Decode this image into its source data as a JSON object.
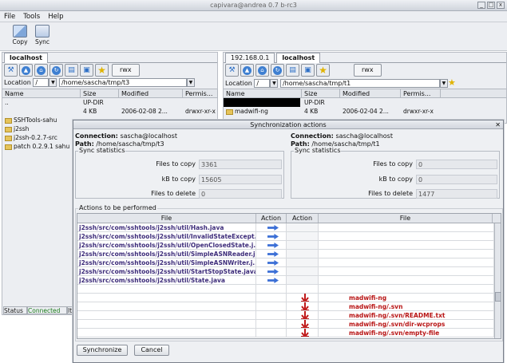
{
  "window": {
    "title": "capivara@andrea 0.7 b-rc3",
    "min_btn": "_",
    "max_btn": "□",
    "close_btn": "x"
  },
  "menu": {
    "file": "File",
    "tools": "Tools",
    "help": "Help"
  },
  "toolbar": {
    "copy": "Copy",
    "sync": "Sync"
  },
  "left": {
    "tab": "localhost",
    "rwx": "rwx",
    "location_label": "Location",
    "location_root": "/",
    "location_path": "/home/sascha/tmp/t3",
    "columns": [
      "Name",
      "Size",
      "Modified",
      "Permis..."
    ],
    "rows": [
      {
        "name": "..",
        "size": "UP-DIR",
        "modified": "",
        "perm": ""
      },
      {
        "name": "",
        "size": "4 KB",
        "modified": "2006-02-08 2...",
        "perm": "drwxr-xr-x"
      },
      {
        "name": "SSHTools-sahu",
        "size": "",
        "modified": "",
        "perm": ""
      },
      {
        "name": "j2ssh",
        "size": "",
        "modified": "",
        "perm": ""
      },
      {
        "name": "j2ssh-0.2.7-src",
        "size": "",
        "modified": "",
        "perm": ""
      },
      {
        "name": "patch 0.2.9.1 sahu",
        "size": "",
        "modified": "",
        "perm": ""
      }
    ],
    "status": [
      "Status",
      "Connected",
      "lt"
    ]
  },
  "right": {
    "tabs": [
      "192.168.0.1",
      "localhost"
    ],
    "rwx": "rwx",
    "location_label": "Location",
    "location_root": "/",
    "location_path": "/home/sascha/tmp/t1",
    "columns": [
      "Name",
      "Size",
      "Modified",
      "Permis..."
    ],
    "rows": [
      {
        "name": "",
        "size": "UP-DIR",
        "modified": "",
        "perm": ""
      },
      {
        "name": "madwifi-ng",
        "size": "4 KB",
        "modified": "2006-02-04 2...",
        "perm": "drwxr-xr-x"
      }
    ]
  },
  "dialog": {
    "title": "Synchronization actions",
    "left": {
      "connection_label": "Connection:",
      "connection": "sascha@localhost",
      "path_label": "Path:",
      "path": "/home/sascha/tmp/t3",
      "stats_legend": "Sync statistics",
      "files_copy_label": "Files to copy",
      "files_copy": "3361",
      "kb_copy_label": "kB to copy",
      "kb_copy": "15605",
      "files_delete_label": "Files to delete",
      "files_delete": "0"
    },
    "right": {
      "connection_label": "Connection:",
      "connection": "sascha@localhost",
      "path_label": "Path:",
      "path": "/home/sascha/tmp/t1",
      "stats_legend": "Sync statistics",
      "files_copy_label": "Files to copy",
      "files_copy": "0",
      "kb_copy_label": "kB to copy",
      "kb_copy": "0",
      "files_delete_label": "Files to delete",
      "files_delete": "1477"
    },
    "actions_legend": "Actions to be performed",
    "columns": [
      "File",
      "Action",
      "Action",
      "File"
    ],
    "copy_rows": [
      "j2ssh/src/com/sshtools/j2ssh/util/Hash.java",
      "j2ssh/src/com/sshtools/j2ssh/util/InvalidStateExcept...",
      "j2ssh/src/com/sshtools/j2ssh/util/OpenClosedState.j...",
      "j2ssh/src/com/sshtools/j2ssh/util/SimpleASNReader.j...",
      "j2ssh/src/com/sshtools/j2ssh/util/SimpleASNWriter.j...",
      "j2ssh/src/com/sshtools/j2ssh/util/StartStopState.java",
      "j2ssh/src/com/sshtools/j2ssh/util/State.java"
    ],
    "delete_rows": [
      "madwifi-ng",
      "madwifi-ng/.svn",
      "madwifi-ng/.svn/README.txt",
      "madwifi-ng/.svn/dir-wcprops",
      "madwifi-ng/.svn/empty-file"
    ],
    "synchronize_button": "Synchronize",
    "cancel_button": "Cancel"
  },
  "colors": {
    "copy_text": "#3d2c7a",
    "delete_text": "#b81414",
    "arrow": "#3b6fd6"
  }
}
